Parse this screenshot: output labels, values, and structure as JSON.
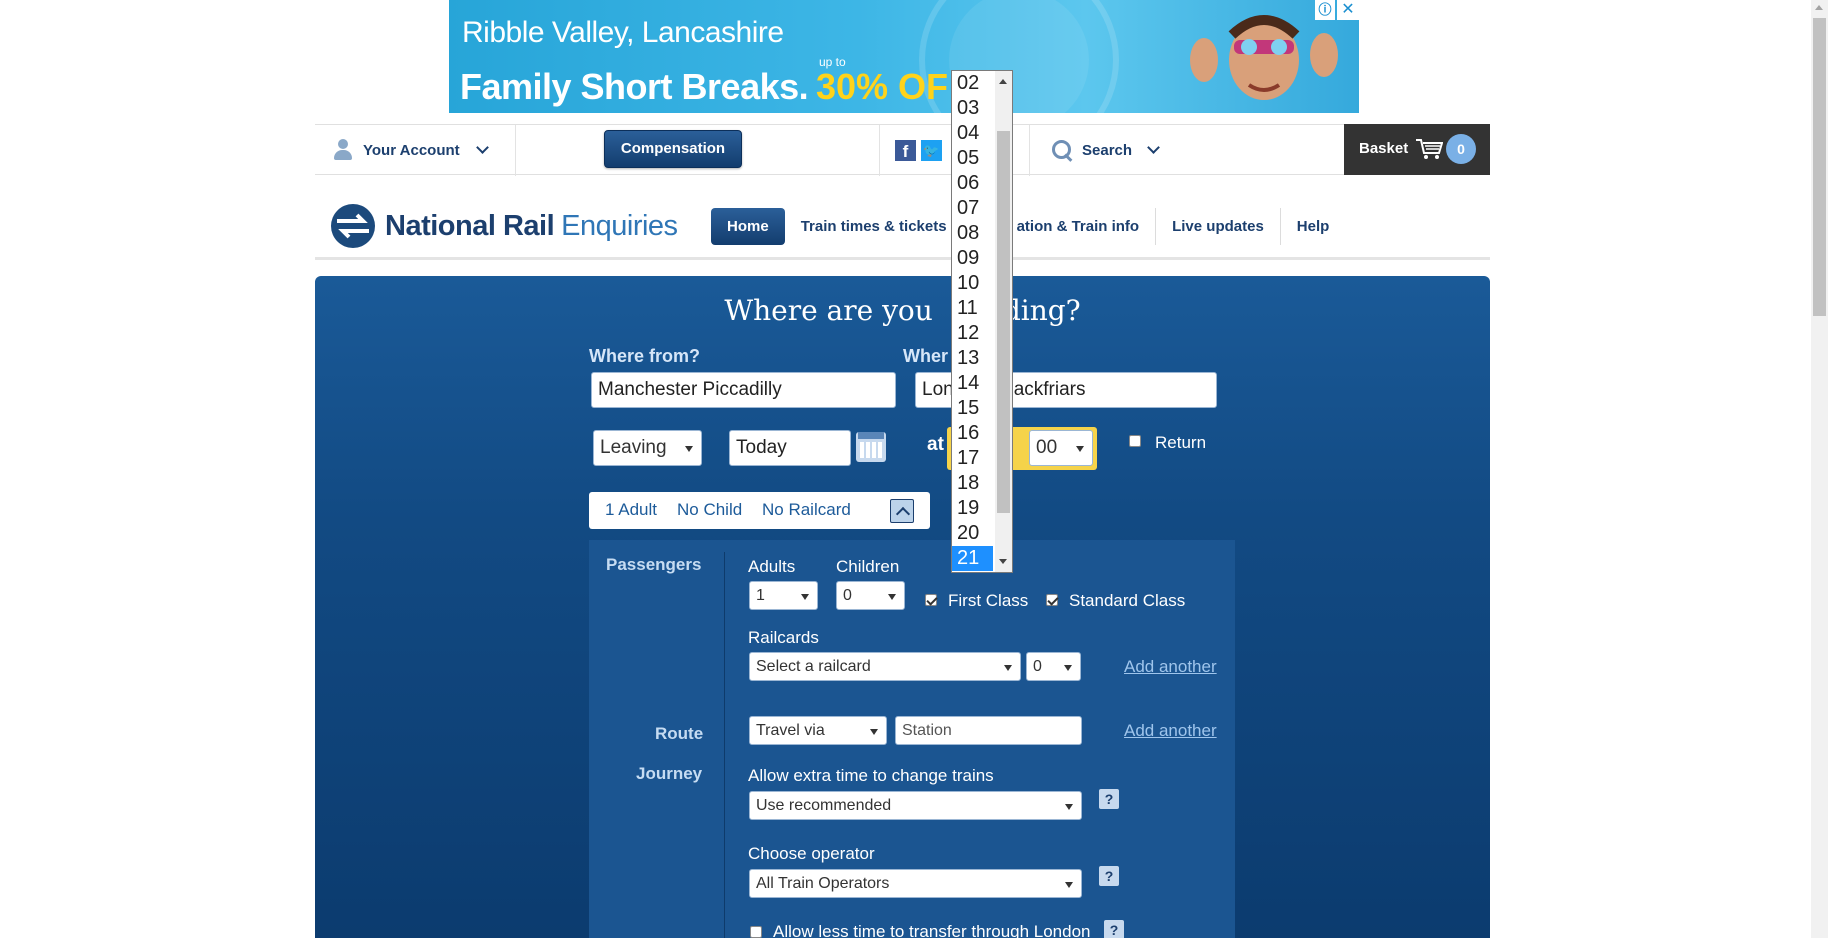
{
  "ad": {
    "line1": "Ribble Valley, Lancashire",
    "line2": "Family Short Breaks.",
    "upto": "up to",
    "percent": "30% OF",
    "adchoices_icon": "info-icon",
    "close_icon": "close-icon"
  },
  "topbar": {
    "account_label": "Your Account",
    "compensation_label": "Compensation",
    "search_label": "Search",
    "basket_label": "Basket",
    "basket_count": "0"
  },
  "logo": {
    "name_bold": "National Rail",
    "name_light": "Enquiries"
  },
  "nav": {
    "items": [
      "Home",
      "Train times & tickets",
      "ation & Train info",
      "Live updates",
      "Help"
    ]
  },
  "journey": {
    "heading_left": "Where are you",
    "heading_right": "ding?",
    "from_label": "Where from?",
    "from_value": "Manchester Piccadilly",
    "to_label": "Wher",
    "to_value_left": "Lon",
    "to_value_right": "ackfriars",
    "leaving_value": "Leaving",
    "date_value": "Today",
    "at_label": "at",
    "minute_value": "00",
    "return_label": "Return"
  },
  "summary": {
    "adults": "1 Adult",
    "children": "No Child",
    "railcard": "No Railcard"
  },
  "options": {
    "passengers_heading": "Passengers",
    "adults_label": "Adults",
    "adults_value": "1",
    "children_label": "Children",
    "children_value": "0",
    "first_class_label": "First Class",
    "standard_class_label": "Standard Class",
    "railcards_label": "Railcards",
    "railcard_select": "Select a railcard",
    "railcard_count": "0",
    "add_another": "Add another",
    "route_heading": "Route",
    "travel_via": "Travel via",
    "station_placeholder": "Station",
    "journey_heading": "Journey",
    "extra_time_label": "Allow extra time to change trains",
    "extra_time_value": "Use recommended",
    "operator_label": "Choose operator",
    "operator_value": "All Train Operators",
    "london_transfer_label": "Allow less time to transfer through London"
  },
  "hour_dropdown": {
    "options": [
      "02",
      "03",
      "04",
      "05",
      "06",
      "07",
      "08",
      "09",
      "10",
      "11",
      "12",
      "13",
      "14",
      "15",
      "16",
      "17",
      "18",
      "19",
      "20",
      "21"
    ],
    "selected": "21"
  },
  "colors": {
    "brand_blue": "#1c3f6e",
    "panel_blue": "#124a83",
    "highlight_yellow": "#f5d34a",
    "selection_blue": "#1e90ff"
  }
}
